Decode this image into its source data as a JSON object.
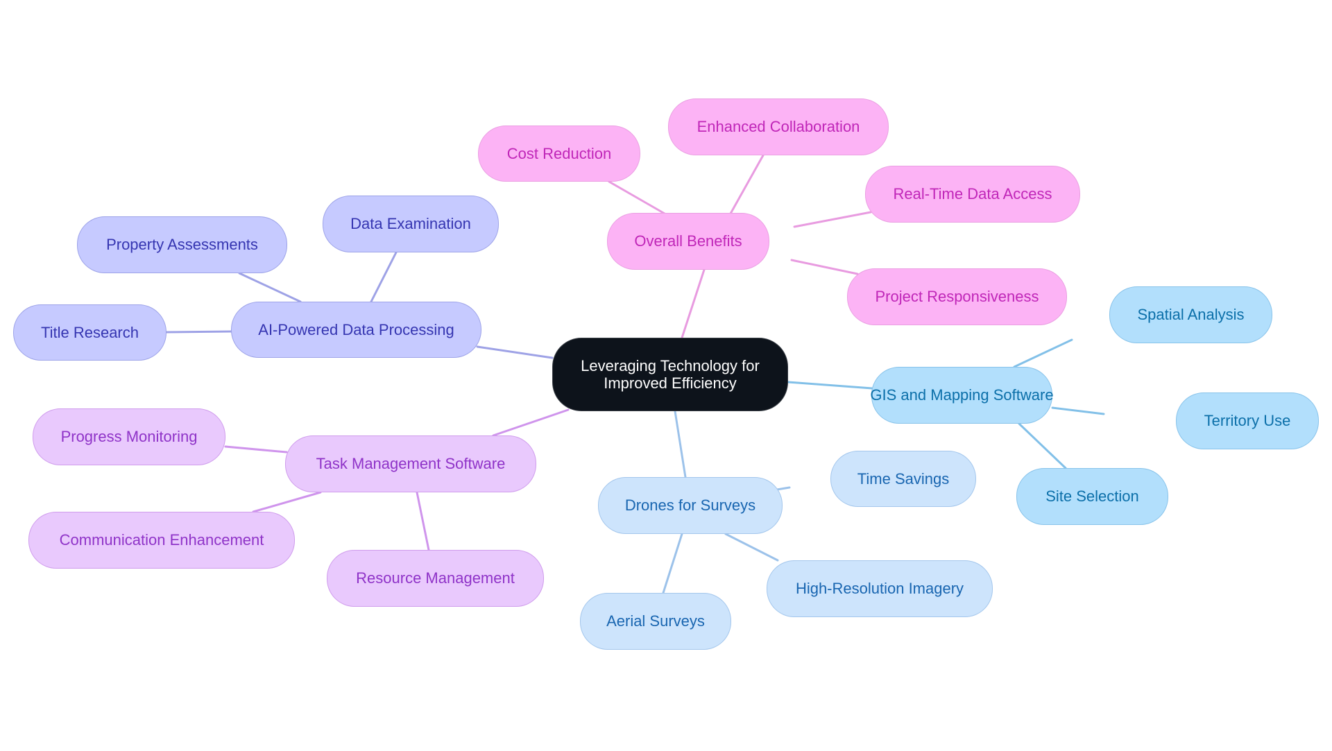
{
  "title": "Leveraging Technology for Improved Efficiency",
  "colors": {
    "root_fill": "#0d131b",
    "benefits": "#e89be0",
    "task": "#cf94ec",
    "ai": "#9ea2e6",
    "gis": "#82c0e8",
    "drones": "#9cc2ea"
  },
  "root": {
    "id": "root",
    "label": "Leveraging Technology for Improved Efficiency"
  },
  "branches": [
    {
      "id": "benefits",
      "label": "Overall Benefits",
      "theme": "pink",
      "children": [
        {
          "id": "cost",
          "label": "Cost Reduction"
        },
        {
          "id": "collab",
          "label": "Enhanced Collaboration"
        },
        {
          "id": "realtime",
          "label": "Real-Time Data Access"
        },
        {
          "id": "responsive",
          "label": "Project Responsiveness"
        }
      ]
    },
    {
      "id": "ai",
      "label": "AI-Powered Data Processing",
      "theme": "indigo",
      "children": [
        {
          "id": "property",
          "label": "Property Assessments"
        },
        {
          "id": "dataexam",
          "label": "Data Examination"
        },
        {
          "id": "title",
          "label": "Title Research"
        }
      ]
    },
    {
      "id": "task",
      "label": "Task Management Software",
      "theme": "purple",
      "children": [
        {
          "id": "progress",
          "label": "Progress Monitoring"
        },
        {
          "id": "comm",
          "label": "Communication Enhancement"
        },
        {
          "id": "resource",
          "label": "Resource Management"
        }
      ]
    },
    {
      "id": "gis",
      "label": "GIS and Mapping Software",
      "theme": "sky",
      "children": [
        {
          "id": "spatial",
          "label": "Spatial Analysis"
        },
        {
          "id": "territory",
          "label": "Territory Use"
        },
        {
          "id": "site",
          "label": "Site Selection"
        }
      ]
    },
    {
      "id": "drones",
      "label": "Drones for Surveys",
      "theme": "blue",
      "children": [
        {
          "id": "time",
          "label": "Time Savings"
        },
        {
          "id": "hires",
          "label": "High-Resolution Imagery"
        },
        {
          "id": "aerial",
          "label": "Aerial Surveys"
        }
      ]
    }
  ]
}
